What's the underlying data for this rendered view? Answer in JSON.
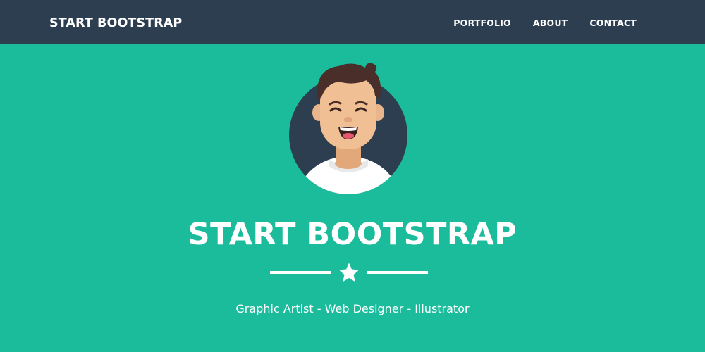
{
  "navbar": {
    "brand": "START BOOTSTRAP",
    "links": [
      "PORTFOLIO",
      "ABOUT",
      "CONTACT"
    ]
  },
  "hero": {
    "title": "START BOOTSTRAP",
    "subtitle": "Graphic Artist - Web Designer - Illustrator",
    "divider_icon": "star-icon",
    "avatar": "avatar-illustration"
  },
  "colors": {
    "navbar_bg": "#2c3e50",
    "hero_bg": "#1abc9c",
    "text": "#ffffff",
    "avatar_circle": "#2c3e50"
  }
}
